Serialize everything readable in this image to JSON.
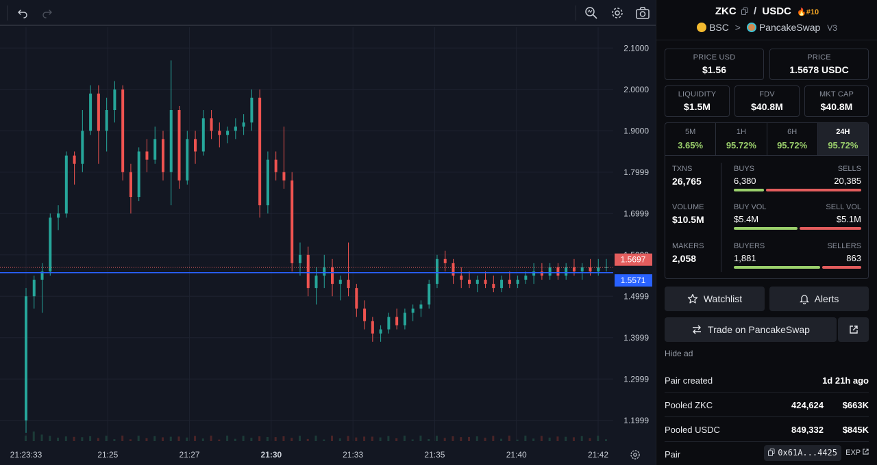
{
  "toolbar": {
    "icons": [
      "undo-icon",
      "redo-icon",
      "indicator-search-icon",
      "gear-icon",
      "camera-icon"
    ]
  },
  "chart_data": {
    "type": "candlestick",
    "y_ticks": [
      "2.1000",
      "2.0000",
      "1.9000",
      "1.7999",
      "1.6999",
      "1.5999",
      "1.4999",
      "1.3999",
      "1.2999",
      "1.1999"
    ],
    "x_ticks": [
      "21:23:33",
      "21:25",
      "21:27",
      "21:30",
      "21:33",
      "21:35",
      "21:40",
      "21:42"
    ],
    "ylim": [
      1.15,
      2.15
    ],
    "price_tags": [
      {
        "label": "1.5697",
        "color": "#e35d5d"
      },
      {
        "label": "1.5571",
        "color": "#2962ff"
      }
    ],
    "candles": [
      {
        "o": 1.2,
        "h": 1.52,
        "l": 1.17,
        "c": 1.5
      },
      {
        "o": 1.5,
        "h": 1.55,
        "l": 1.47,
        "c": 1.54
      },
      {
        "o": 1.54,
        "h": 1.58,
        "l": 1.46,
        "c": 1.56
      },
      {
        "o": 1.56,
        "h": 1.7,
        "l": 1.55,
        "c": 1.69
      },
      {
        "o": 1.69,
        "h": 1.72,
        "l": 1.66,
        "c": 1.7
      },
      {
        "o": 1.7,
        "h": 1.85,
        "l": 1.69,
        "c": 1.84
      },
      {
        "o": 1.84,
        "h": 1.85,
        "l": 1.77,
        "c": 1.82
      },
      {
        "o": 1.82,
        "h": 1.95,
        "l": 1.8,
        "c": 1.9
      },
      {
        "o": 1.9,
        "h": 2.01,
        "l": 1.89,
        "c": 1.99
      },
      {
        "o": 1.99,
        "h": 2.01,
        "l": 1.82,
        "c": 1.9
      },
      {
        "o": 1.9,
        "h": 1.98,
        "l": 1.85,
        "c": 1.95
      },
      {
        "o": 1.95,
        "h": 2.02,
        "l": 1.92,
        "c": 2.0
      },
      {
        "o": 2.0,
        "h": 2.01,
        "l": 1.78,
        "c": 1.8
      },
      {
        "o": 1.8,
        "h": 1.82,
        "l": 1.7,
        "c": 1.74
      },
      {
        "o": 1.74,
        "h": 1.86,
        "l": 1.73,
        "c": 1.85
      },
      {
        "o": 1.85,
        "h": 1.88,
        "l": 1.8,
        "c": 1.83
      },
      {
        "o": 1.83,
        "h": 1.91,
        "l": 1.82,
        "c": 1.88
      },
      {
        "o": 1.88,
        "h": 1.9,
        "l": 1.78,
        "c": 1.8
      },
      {
        "o": 1.8,
        "h": 2.07,
        "l": 1.72,
        "c": 1.95
      },
      {
        "o": 1.95,
        "h": 1.96,
        "l": 1.76,
        "c": 1.78
      },
      {
        "o": 1.78,
        "h": 1.9,
        "l": 1.77,
        "c": 1.88
      },
      {
        "o": 1.88,
        "h": 1.9,
        "l": 1.82,
        "c": 1.85
      },
      {
        "o": 1.85,
        "h": 1.95,
        "l": 1.84,
        "c": 1.93
      },
      {
        "o": 1.93,
        "h": 1.95,
        "l": 1.88,
        "c": 1.9
      },
      {
        "o": 1.9,
        "h": 1.92,
        "l": 1.86,
        "c": 1.89
      },
      {
        "o": 1.89,
        "h": 1.91,
        "l": 1.87,
        "c": 1.9
      },
      {
        "o": 1.9,
        "h": 1.93,
        "l": 1.88,
        "c": 1.91
      },
      {
        "o": 1.91,
        "h": 1.94,
        "l": 1.89,
        "c": 1.92
      },
      {
        "o": 1.92,
        "h": 2.0,
        "l": 1.9,
        "c": 1.98
      },
      {
        "o": 1.98,
        "h": 2.0,
        "l": 1.69,
        "c": 1.72
      },
      {
        "o": 1.72,
        "h": 1.85,
        "l": 1.7,
        "c": 1.83
      },
      {
        "o": 1.83,
        "h": 1.85,
        "l": 1.78,
        "c": 1.8
      },
      {
        "o": 1.8,
        "h": 1.91,
        "l": 1.76,
        "c": 1.78
      },
      {
        "o": 1.78,
        "h": 1.8,
        "l": 1.56,
        "c": 1.58
      },
      {
        "o": 1.58,
        "h": 1.63,
        "l": 1.55,
        "c": 1.6
      },
      {
        "o": 1.6,
        "h": 1.62,
        "l": 1.5,
        "c": 1.52
      },
      {
        "o": 1.52,
        "h": 1.57,
        "l": 1.48,
        "c": 1.55
      },
      {
        "o": 1.55,
        "h": 1.6,
        "l": 1.52,
        "c": 1.57
      },
      {
        "o": 1.57,
        "h": 1.59,
        "l": 1.5,
        "c": 1.53
      },
      {
        "o": 1.53,
        "h": 1.55,
        "l": 1.49,
        "c": 1.54
      },
      {
        "o": 1.54,
        "h": 1.63,
        "l": 1.5,
        "c": 1.52
      },
      {
        "o": 1.52,
        "h": 1.53,
        "l": 1.45,
        "c": 1.47
      },
      {
        "o": 1.47,
        "h": 1.49,
        "l": 1.42,
        "c": 1.44
      },
      {
        "o": 1.44,
        "h": 1.45,
        "l": 1.39,
        "c": 1.41
      },
      {
        "o": 1.41,
        "h": 1.43,
        "l": 1.39,
        "c": 1.42
      },
      {
        "o": 1.42,
        "h": 1.46,
        "l": 1.41,
        "c": 1.45
      },
      {
        "o": 1.45,
        "h": 1.47,
        "l": 1.42,
        "c": 1.43
      },
      {
        "o": 1.43,
        "h": 1.47,
        "l": 1.42,
        "c": 1.46
      },
      {
        "o": 1.46,
        "h": 1.48,
        "l": 1.44,
        "c": 1.47
      },
      {
        "o": 1.47,
        "h": 1.49,
        "l": 1.45,
        "c": 1.48
      },
      {
        "o": 1.48,
        "h": 1.54,
        "l": 1.47,
        "c": 1.53
      },
      {
        "o": 1.53,
        "h": 1.6,
        "l": 1.52,
        "c": 1.59
      },
      {
        "o": 1.59,
        "h": 1.61,
        "l": 1.56,
        "c": 1.58
      },
      {
        "o": 1.58,
        "h": 1.59,
        "l": 1.53,
        "c": 1.55
      },
      {
        "o": 1.55,
        "h": 1.57,
        "l": 1.52,
        "c": 1.54
      },
      {
        "o": 1.54,
        "h": 1.56,
        "l": 1.52,
        "c": 1.53
      },
      {
        "o": 1.53,
        "h": 1.55,
        "l": 1.51,
        "c": 1.54
      },
      {
        "o": 1.54,
        "h": 1.56,
        "l": 1.52,
        "c": 1.53
      },
      {
        "o": 1.53,
        "h": 1.55,
        "l": 1.51,
        "c": 1.52
      },
      {
        "o": 1.52,
        "h": 1.55,
        "l": 1.51,
        "c": 1.54
      },
      {
        "o": 1.54,
        "h": 1.56,
        "l": 1.52,
        "c": 1.53
      },
      {
        "o": 1.53,
        "h": 1.55,
        "l": 1.52,
        "c": 1.54
      },
      {
        "o": 1.54,
        "h": 1.56,
        "l": 1.53,
        "c": 1.55
      },
      {
        "o": 1.55,
        "h": 1.58,
        "l": 1.53,
        "c": 1.56
      },
      {
        "o": 1.56,
        "h": 1.58,
        "l": 1.54,
        "c": 1.55
      },
      {
        "o": 1.55,
        "h": 1.58,
        "l": 1.54,
        "c": 1.57
      },
      {
        "o": 1.57,
        "h": 1.58,
        "l": 1.54,
        "c": 1.55
      },
      {
        "o": 1.55,
        "h": 1.58,
        "l": 1.54,
        "c": 1.57
      },
      {
        "o": 1.57,
        "h": 1.59,
        "l": 1.55,
        "c": 1.56
      },
      {
        "o": 1.56,
        "h": 1.58,
        "l": 1.54,
        "c": 1.57
      },
      {
        "o": 1.57,
        "h": 1.59,
        "l": 1.55,
        "c": 1.56
      },
      {
        "o": 1.56,
        "h": 1.59,
        "l": 1.55,
        "c": 1.57
      },
      {
        "o": 1.57,
        "h": 1.59,
        "l": 1.56,
        "c": 1.57
      }
    ],
    "volume_bars": 72
  },
  "header": {
    "base": "ZKC",
    "sep": "/",
    "quote": "USDC",
    "rank": "#10",
    "chain": "BSC",
    "arrow": ">",
    "dex": "PancakeSwap",
    "version": "V3"
  },
  "prices": {
    "usd_label": "PRICE USD",
    "usd_value": "$1.56",
    "native_label": "PRICE",
    "native_value": "1.5678 USDC"
  },
  "caps": {
    "liq_label": "LIQUIDITY",
    "liq_value": "$1.5M",
    "fdv_label": "FDV",
    "fdv_value": "$40.8M",
    "mcap_label": "MKT CAP",
    "mcap_value": "$40.8M"
  },
  "timeframes": [
    {
      "k": "5M",
      "p": "3.65%"
    },
    {
      "k": "1H",
      "p": "95.72%"
    },
    {
      "k": "6H",
      "p": "95.72%"
    },
    {
      "k": "24H",
      "p": "95.72%"
    }
  ],
  "stats": {
    "txns_label": "TXNS",
    "txns": "26,765",
    "volume_label": "VOLUME",
    "volume": "$10.5M",
    "makers_label": "MAKERS",
    "makers": "2,058",
    "buys_label": "BUYS",
    "buys": "6,380",
    "sells_label": "SELLS",
    "sells": "20,385",
    "buy_vol_label": "BUY VOL",
    "buy_vol": "$5.4M",
    "sell_vol_label": "SELL VOL",
    "sell_vol": "$5.1M",
    "buyers_label": "BUYERS",
    "buyers": "1,881",
    "sellers_label": "SELLERS",
    "sellers": "863",
    "buys_ratio": 0.24,
    "buy_vol_ratio": 0.51,
    "buyers_ratio": 0.69
  },
  "buttons": {
    "watchlist": "Watchlist",
    "alerts": "Alerts",
    "trade": "Trade on PancakeSwap",
    "hide_ad": "Hide ad"
  },
  "info": {
    "created_label": "Pair created",
    "created_value": "1d 21h ago",
    "pooled_base_label": "Pooled ZKC",
    "pooled_base_amt": "424,624",
    "pooled_base_usd": "$663K",
    "pooled_quote_label": "Pooled USDC",
    "pooled_quote_amt": "849,332",
    "pooled_quote_usd": "$845K",
    "pair_label": "Pair",
    "pair_addr": "0x61A...4425",
    "exp": "EXP"
  },
  "colors": {
    "up": "#26a69a",
    "down": "#ef5350",
    "green": "#9bd06c",
    "red": "#e35d5d",
    "blue": "#2962ff"
  }
}
